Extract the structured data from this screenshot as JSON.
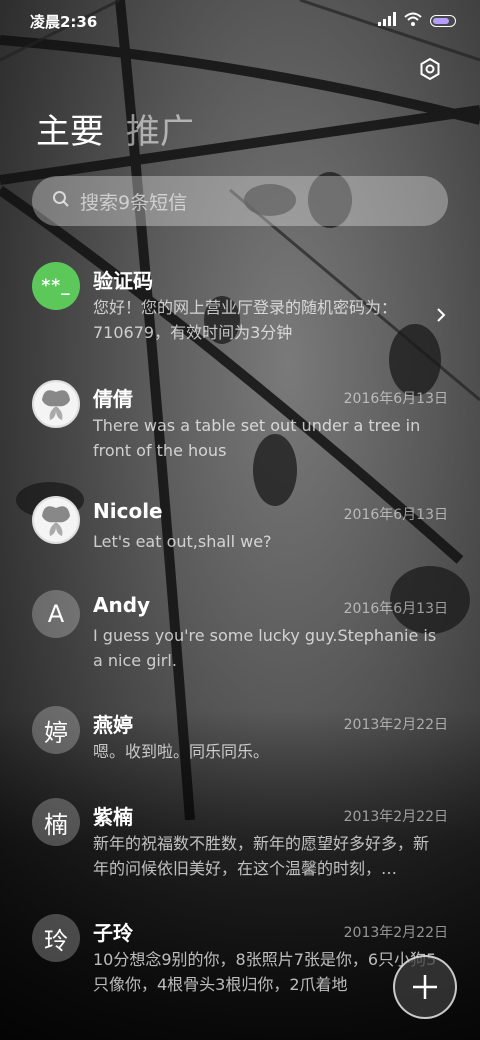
{
  "status_bar": {
    "time": "凌晨2:36"
  },
  "tabs": [
    {
      "label": "主要"
    },
    {
      "label": "推广"
    }
  ],
  "search": {
    "placeholder": "搜索9条短信"
  },
  "conversations": [
    {
      "avatar_text": "**_",
      "name": "验证码",
      "date": "",
      "preview": "您好！您的网上营业厅登录的随机密码为：710679，有效时间为3分钟"
    },
    {
      "avatar_text": "",
      "name": "倩倩",
      "date": "2016年6月13日",
      "preview": "There was a table set out under a tree in front of the hous"
    },
    {
      "avatar_text": "",
      "name": "Nicole",
      "date": "2016年6月13日",
      "preview": "Let's eat out,shall we?"
    },
    {
      "avatar_text": "A",
      "name": "Andy",
      "date": "2016年6月13日",
      "preview": "I guess you're some lucky guy.Stephanie is a nice girl."
    },
    {
      "avatar_text": "婷",
      "name": "燕婷",
      "date": "2013年2月22日",
      "preview": "嗯。收到啦。同乐同乐。"
    },
    {
      "avatar_text": "楠",
      "name": "紫楠",
      "date": "2013年2月22日",
      "preview": "新年的祝福数不胜数，新年的愿望好多好多，新年的问候依旧美好，在这个温馨的时刻，…"
    },
    {
      "avatar_text": "玲",
      "name": "子玲",
      "date": "2013年2月22日",
      "preview": "10分想念9别的你，8张照片7张是你，6只小狗5只像你，4根骨头3根归你，2爪着地"
    }
  ],
  "colors": {
    "battery": "#b59cff",
    "verify_avatar": "#5cc85a"
  },
  "icons": [
    "signal-icon",
    "wifi-icon",
    "battery-icon",
    "settings-icon",
    "search-icon",
    "chevron-right-icon",
    "plus-icon"
  ]
}
